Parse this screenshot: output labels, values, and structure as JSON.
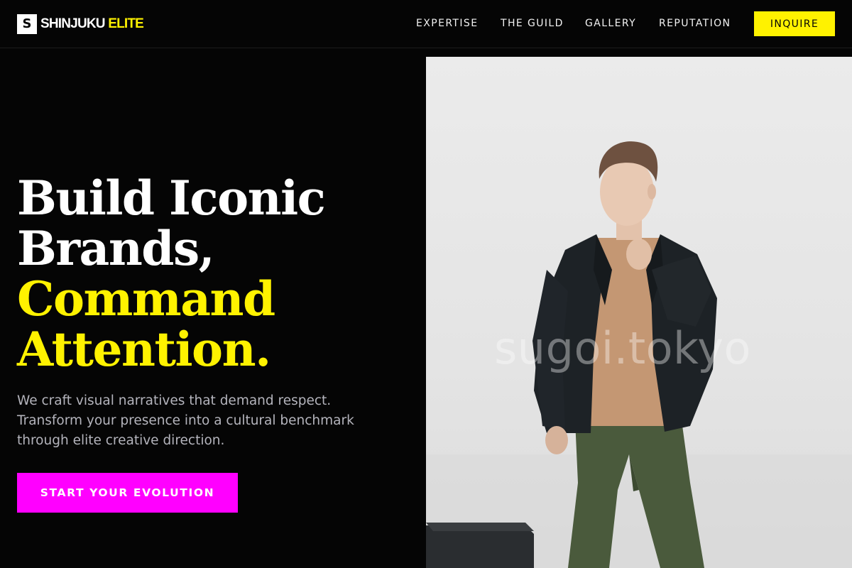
{
  "brand": {
    "logo_mark": "S",
    "name_primary": "SHINJUKU",
    "name_accent": "ELITE"
  },
  "nav": {
    "items": [
      {
        "label": "EXPERTISE"
      },
      {
        "label": "THE GUILD"
      },
      {
        "label": "GALLERY"
      },
      {
        "label": "REPUTATION"
      }
    ],
    "cta_label": "INQUIRE"
  },
  "hero": {
    "title_lines": [
      "Build Iconic",
      "Brands,"
    ],
    "title_accent_lines": [
      "Command",
      "Attention."
    ],
    "subtitle_lines": [
      "We craft visual narratives that demand respect.",
      "Transform your presence into a cultural benchmark",
      "through elite creative direction."
    ],
    "cta_label": "START YOUR EVOLUTION",
    "image_watermark": "sugoi.tokyo"
  },
  "colors": {
    "background": "#050505",
    "accent_yellow": "#fff200",
    "accent_magenta": "#ff00ff",
    "subtitle_gray": "#b4b4bc"
  }
}
